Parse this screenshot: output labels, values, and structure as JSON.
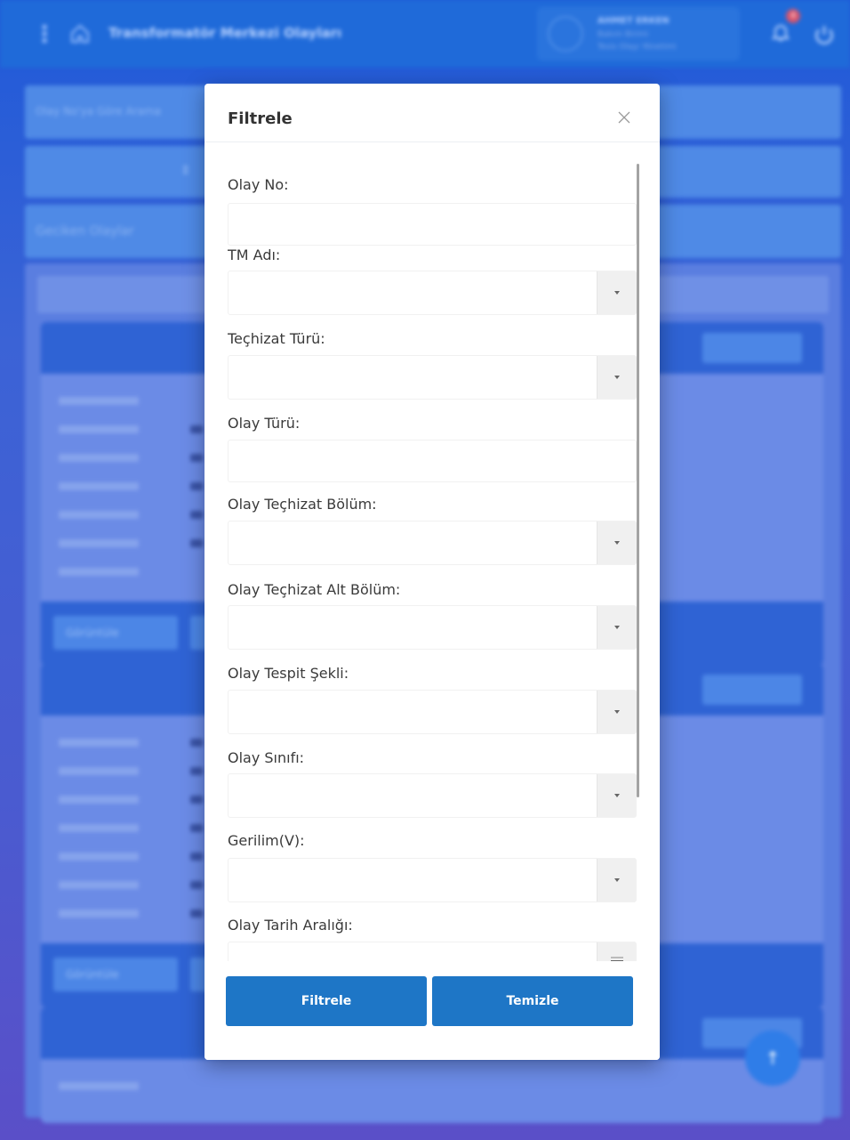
{
  "app": {
    "title": "Transformatör Merkezi Olayları",
    "user_name": "AHMET ERKEN",
    "user_role_line1": "Bakım Birimi",
    "user_role_line2": "Tesis Olayı Yönetimi",
    "notification_count": "4"
  },
  "background": {
    "search_placeholder": "Olay No'ya Göre Arama",
    "late_events": "Geciken Olaylar",
    "view_button": "Görüntüle"
  },
  "modal": {
    "title": "Filtrele",
    "fields": [
      {
        "label": "Olay No:",
        "type": "text",
        "value": ""
      },
      {
        "label": "TM Adı:",
        "type": "select",
        "value": ""
      },
      {
        "label": "Teçhizat Türü:",
        "type": "select",
        "value": ""
      },
      {
        "label": "Olay Türü:",
        "type": "text",
        "value": ""
      },
      {
        "label": "Olay Teçhizat Bölüm:",
        "type": "select",
        "value": ""
      },
      {
        "label": "Olay Teçhizat Alt Bölüm:",
        "type": "select",
        "value": ""
      },
      {
        "label": "Olay Tespit Şekli:",
        "type": "select",
        "value": ""
      },
      {
        "label": "Olay Sınıfı:",
        "type": "select",
        "value": ""
      },
      {
        "label": "Gerilim(V):",
        "type": "select",
        "value": ""
      },
      {
        "label": "Olay Tarih Aralığı:",
        "type": "daterange",
        "value": ""
      }
    ],
    "filter_button": "Filtrele",
    "clear_button": "Temizle"
  },
  "colors": {
    "primary_button": "#1e76c6",
    "topbar": "#1f6ad9"
  }
}
